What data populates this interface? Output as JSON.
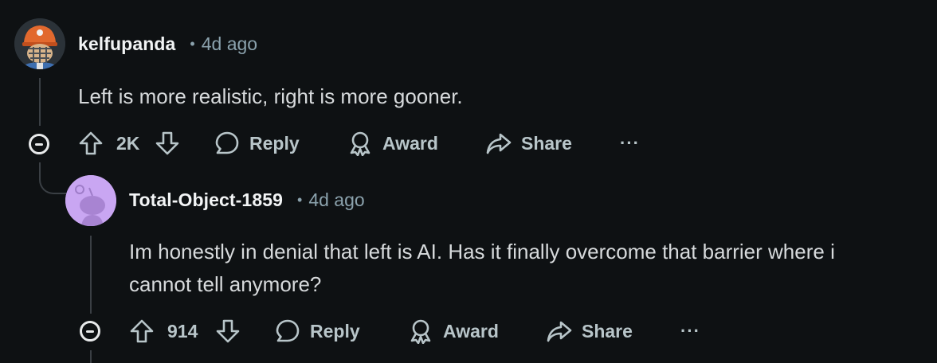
{
  "comments": [
    {
      "username": "kelfupanda",
      "separator": "•",
      "time": "4d ago",
      "body": "Left is more realistic, right is more gooner.",
      "score": "2K",
      "actions": {
        "reply": "Reply",
        "award": "Award",
        "share": "Share",
        "more": "···"
      }
    },
    {
      "username": "Total-Object-1859",
      "separator": "•",
      "time": "4d ago",
      "body_lines": [
        "Im honestly in denial that left is AI. Has it finally overcome that barrier where i",
        "cannot tell anymore?"
      ],
      "score": "914",
      "actions": {
        "reply": "Reply",
        "award": "Award",
        "share": "Share",
        "more": "···"
      }
    }
  ],
  "colors": {
    "background": "#0e1113",
    "text": "#d7dadc",
    "muted": "#8ba2ad",
    "action": "#b8c5c9",
    "thread": "#3a3f44",
    "snoo_avatar": "#c9a6f2"
  },
  "icons": {
    "upvote": "upvote-arrow-icon",
    "downvote": "downvote-arrow-icon",
    "reply": "speech-bubble-icon",
    "award": "award-ribbon-icon",
    "share": "share-arrow-icon",
    "collapse": "collapse-minus-icon"
  }
}
